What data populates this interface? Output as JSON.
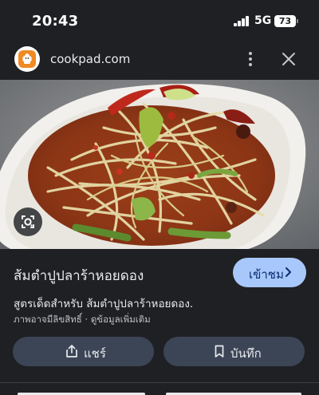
{
  "status_bar": {
    "time": "20:43",
    "network": "5G",
    "battery": "73"
  },
  "source": {
    "site_name": "cookpad.com",
    "logo_icon": "cookpad-chef-hat-icon",
    "brand_color": "#f08a24"
  },
  "image": {
    "subject": "papaya-salad-photo",
    "lens_icon": "google-lens-icon"
  },
  "result": {
    "title": "ส้มตำปูปลาร้าหอยดอง",
    "visit_label": "เข้าชม",
    "description": "สูตรเด็ดสำหรับ ส้มตำปูปลาร้าหอยดอง.",
    "copyright_text": "ภาพอาจมีลิขสิทธิ์",
    "more_info_link": "ดูข้อมูลเพิ่มเติม"
  },
  "actions": {
    "share_label": "แชร์",
    "save_label": "บันทึก"
  },
  "colors": {
    "background": "#1f2023",
    "visit_button": "#a8c7fa",
    "action_button": "#3c4556"
  }
}
